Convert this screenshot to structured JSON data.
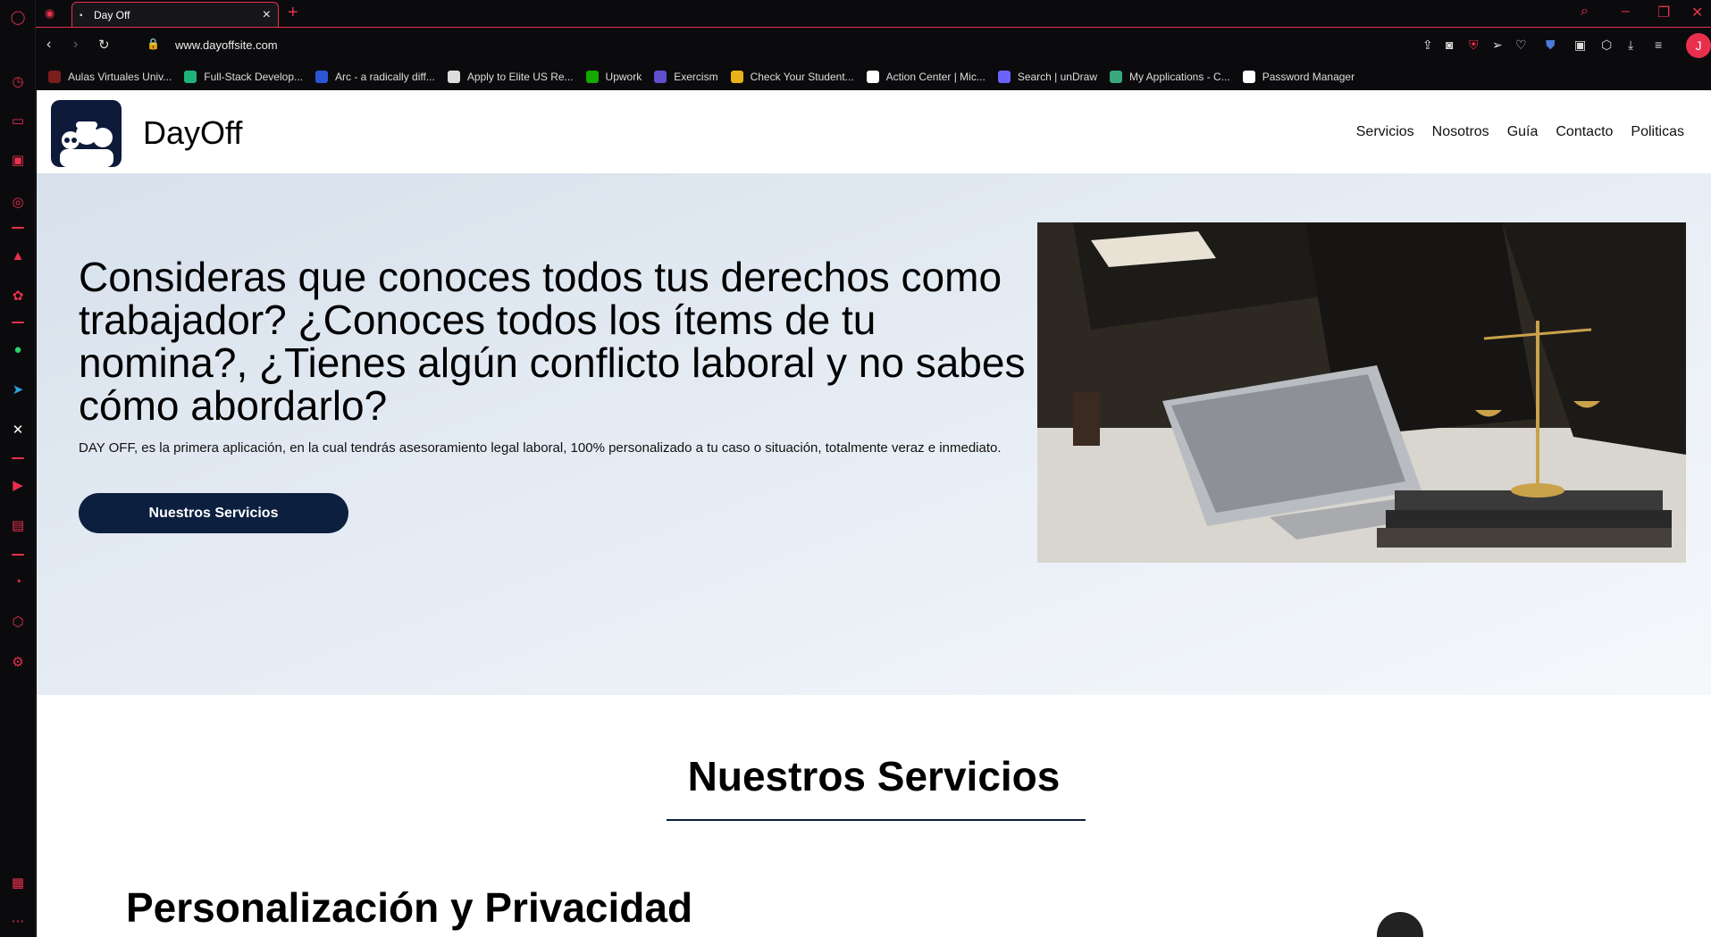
{
  "browser": {
    "tab_title": "Day Off",
    "url": "www.dayoffsite.com",
    "avatar_letter": "J",
    "accent_color": "#e8304c"
  },
  "bookmarks": [
    {
      "label": "Aulas Virtuales Univ...",
      "color": "#7a1d1d"
    },
    {
      "label": "Full-Stack Develop...",
      "color": "#1fb37a"
    },
    {
      "label": "Arc - a radically diff...",
      "color": "#2c56d6"
    },
    {
      "label": "Apply to Elite US Re...",
      "color": "#dddddd"
    },
    {
      "label": "Upwork",
      "color": "#14a800"
    },
    {
      "label": "Exercism",
      "color": "#604fcd"
    },
    {
      "label": "Check Your Student...",
      "color": "#e8b218"
    },
    {
      "label": "Action Center | Mic...",
      "color": "#ffffff"
    },
    {
      "label": "Search | unDraw",
      "color": "#6c63ff"
    },
    {
      "label": "My Applications - C...",
      "color": "#3aa87c"
    },
    {
      "label": "Password Manager",
      "color": "#ffffff"
    }
  ],
  "site": {
    "brand": "DayOff",
    "menu": [
      "Servicios",
      "Nosotros",
      "Guía",
      "Contacto",
      "Politicas"
    ],
    "hero": {
      "title": "Consideras que conoces todos tus derechos como trabajador? ¿Conoces todos los ítems de tu nomina?, ¿Tienes algún conflicto laboral y no sabes cómo abordarlo?",
      "text": "DAY OFF, es la primera aplicación, en la cual tendrás asesoramiento legal laboral, 100% personalizado a tu caso o situación, totalmente veraz e inmediato.",
      "button": "Nuestros Servicios"
    },
    "services": {
      "title": "Nuestros Servicios",
      "first_item_title": "Personalización y Privacidad"
    }
  }
}
